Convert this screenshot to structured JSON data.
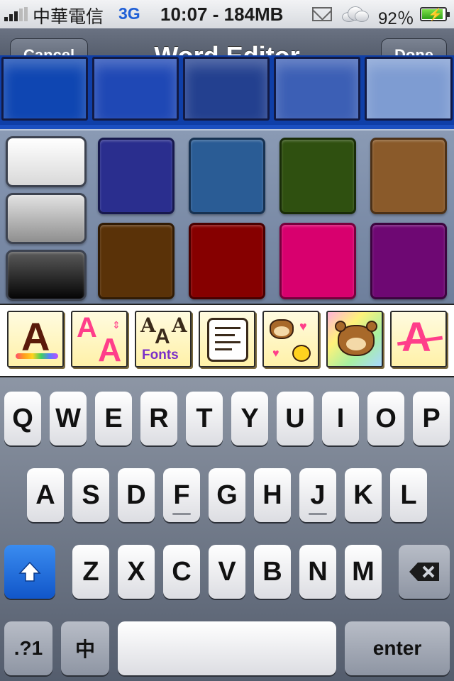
{
  "status_bar": {
    "carrier": "中華電信",
    "network": "3G",
    "time_memory": "10:07 - 184MB",
    "battery_percent": "92％",
    "battery_level": 0.92,
    "icons": [
      "signal-bars-icon",
      "mail-icon",
      "cloud-icon",
      "battery-charging-icon"
    ]
  },
  "nav_bar": {
    "title": "Word Editor",
    "cancel_label": "Cancel",
    "done_label": "Done"
  },
  "color_picker": {
    "selected_row": [
      "#0f46b2",
      "#1f48b5",
      "#23408f",
      "#3c5fb5",
      "#7e9cd2"
    ],
    "grays": [
      "#f2f2f2",
      "#b4b4b4",
      "#1a1a1a"
    ],
    "palette": [
      "#2a2e8e",
      "#2a5c95",
      "#2f5010",
      "#8a5a2a",
      "#5a3208",
      "#860000",
      "#d8006e",
      "#6e0873"
    ]
  },
  "sticker_toolbar": {
    "buttons": [
      {
        "name": "text-color-button",
        "icon": "letter-a-color-icon",
        "glyph": "A"
      },
      {
        "name": "text-size-button",
        "icon": "font-size-icon",
        "glyph": "A"
      },
      {
        "name": "fonts-button",
        "icon": "fonts-icon",
        "glyph": "A",
        "label": "Fonts"
      },
      {
        "name": "text-align-button",
        "icon": "notepad-lines-icon"
      },
      {
        "name": "bear-stickers-button",
        "icon": "bear-hearts-icon"
      },
      {
        "name": "bear-background-button",
        "icon": "bear-rainbow-icon"
      },
      {
        "name": "text-style-button",
        "icon": "strikethrough-a-icon",
        "glyph": "A"
      }
    ]
  },
  "keyboard": {
    "row1": [
      "Q",
      "W",
      "E",
      "R",
      "T",
      "Y",
      "U",
      "I",
      "O",
      "P"
    ],
    "row2": [
      "A",
      "S",
      "D",
      "F",
      "G",
      "H",
      "J",
      "K",
      "L"
    ],
    "row3": [
      "Z",
      "X",
      "C",
      "V",
      "B",
      "N",
      "M"
    ],
    "numbers_label": ".?1",
    "lang_label": "中",
    "enter_label": "enter"
  }
}
